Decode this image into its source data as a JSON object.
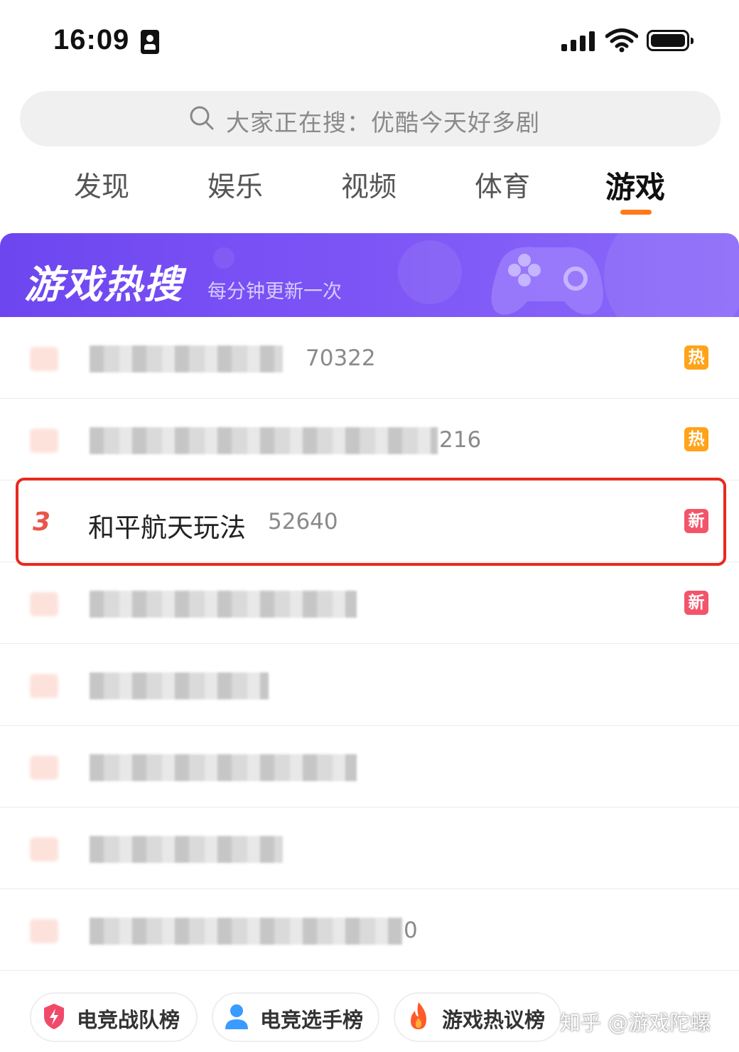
{
  "status_bar": {
    "time": "16:09"
  },
  "search": {
    "placeholder": "大家正在搜：优酷今天好多剧"
  },
  "tabs": [
    {
      "label": "发现"
    },
    {
      "label": "娱乐"
    },
    {
      "label": "视频"
    },
    {
      "label": "体育"
    },
    {
      "label": "游戏",
      "active": true
    }
  ],
  "banner": {
    "title": "游戏热搜",
    "subtitle": "每分钟更新一次"
  },
  "list": [
    {
      "rank": "",
      "title": "",
      "count": "70322",
      "tag": "热",
      "tag_type": "hot"
    },
    {
      "rank": "",
      "title": "",
      "count": "216",
      "tag": "热",
      "tag_type": "hot"
    },
    {
      "rank": "3",
      "title": "和平航天玩法",
      "count": "52640",
      "tag": "新",
      "tag_type": "new",
      "highlighted": true
    },
    {
      "rank": "",
      "title": "",
      "count": "",
      "tag": "新",
      "tag_type": "new"
    },
    {
      "rank": "",
      "title": "",
      "count": "",
      "tag": ""
    },
    {
      "rank": "",
      "title": "",
      "count": "",
      "tag": ""
    },
    {
      "rank": "",
      "title": "",
      "count": "",
      "tag": ""
    },
    {
      "rank": "",
      "title": "",
      "count": "0",
      "tag": ""
    }
  ],
  "bottom_buttons": [
    {
      "label": "电竞战队榜",
      "icon": "shield-bolt-icon"
    },
    {
      "label": "电竞选手榜",
      "icon": "person-icon"
    },
    {
      "label": "游戏热议榜",
      "icon": "flame-icon"
    }
  ],
  "watermark": "知乎 @游戏陀螺",
  "colors": {
    "accent": "#ff7a1a",
    "banner": "#7d55f6",
    "hot_tag": "#ffa31a",
    "new_tag": "#f2556a",
    "highlight_border": "#e8291e"
  }
}
